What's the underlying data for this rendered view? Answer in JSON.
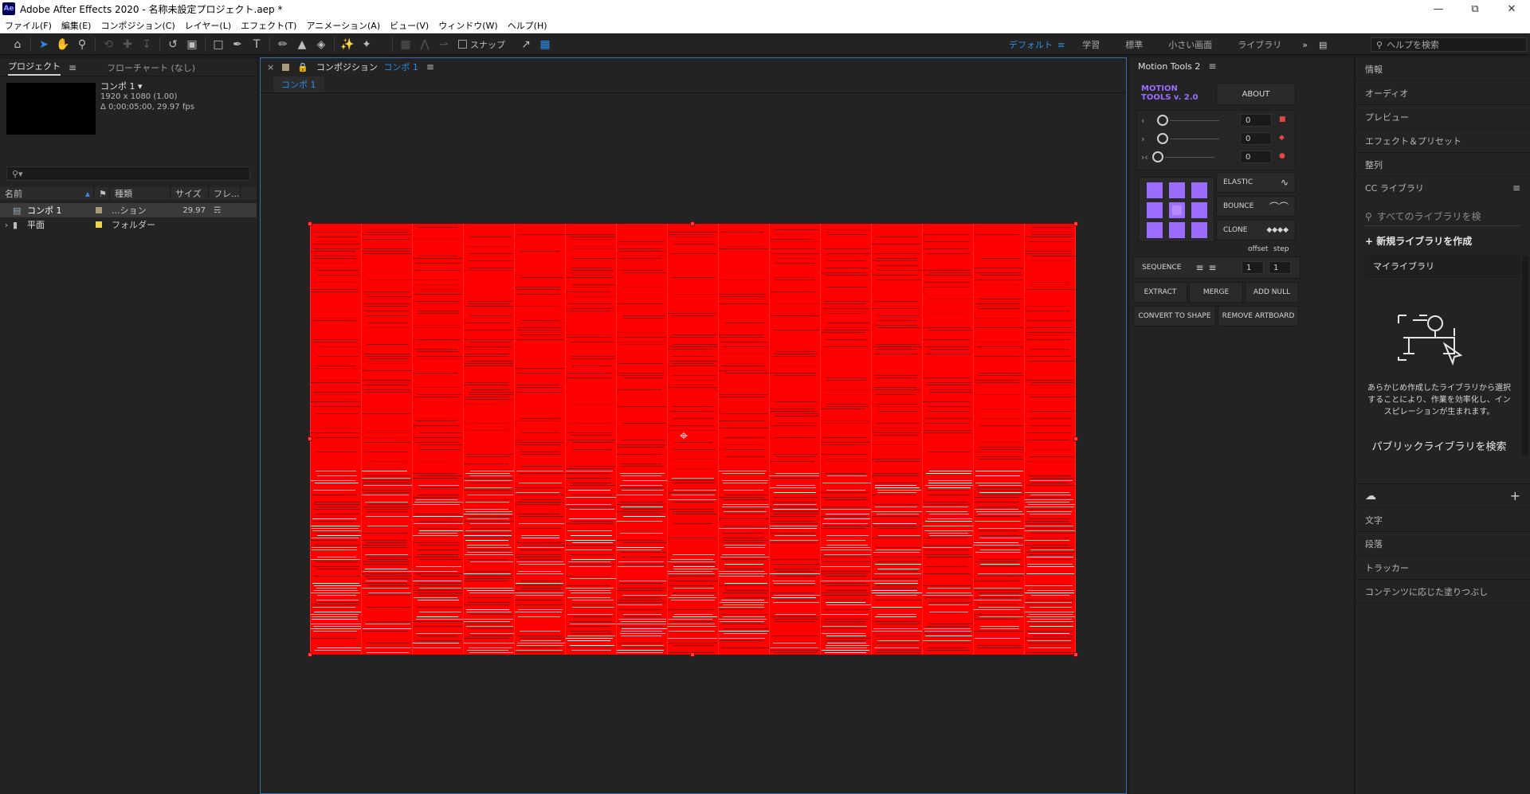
{
  "window": {
    "title": "Adobe After Effects 2020 - 名称未設定プロジェクト.aep *",
    "logo": "Ae"
  },
  "menu": [
    "ファイル(F)",
    "編集(E)",
    "コンポジション(C)",
    "レイヤー(L)",
    "エフェクト(T)",
    "アニメーション(A)",
    "ビュー(V)",
    "ウィンドウ(W)",
    "ヘルプ(H)"
  ],
  "toolbar": {
    "snap_label": "スナップ",
    "workspaces": [
      "デフォルト",
      "学習",
      "標準",
      "小さい画面",
      "ライブラリ"
    ],
    "active_workspace": "デフォルト",
    "search_placeholder": "ヘルプを検索"
  },
  "project": {
    "tab_project": "プロジェクト",
    "tab_flowchart": "フローチャート (なし)",
    "comp_name": "コンポ 1 ▾",
    "comp_size": "1920 x 1080 (1.00)",
    "comp_duration": "Δ 0;00;05;00, 29.97 fps",
    "columns": [
      "名前",
      "種類",
      "サイズ",
      "フレ..."
    ],
    "items": [
      {
        "name": "コンポ 1",
        "type": "...ション",
        "fps": "29.97",
        "color": "#a89a7a"
      },
      {
        "name": "平面",
        "type": "フォルダー",
        "fps": "",
        "color": "#e8d44d"
      }
    ]
  },
  "composition": {
    "tab_label": "コンポジション",
    "tab_comp_name": "コンポ 1",
    "sub_tab": "コンポ 1",
    "canvas_color": "#ff0000"
  },
  "motion_tools": {
    "title": "Motion Tools 2",
    "logo_line1": "MOTION",
    "logo_line2": "TOOLS v. 2.0",
    "about": "ABOUT",
    "slider_values": [
      "0",
      "0",
      "0"
    ],
    "elastic": "ELASTIC",
    "bounce": "BOUNCE",
    "clone": "CLONE",
    "offset": "offset",
    "step": "step",
    "sequence": "SEQUENCE",
    "seq_offset": "1",
    "seq_step": "1",
    "extract": "EXTRACT",
    "merge": "MERGE",
    "add_null": "ADD NULL",
    "convert_to_shape": "CONVERT TO SHAPE",
    "remove_artboard": "REMOVE ARTBOARD",
    "accent": "#9b6cff"
  },
  "right_panel": {
    "items_top": [
      "情報",
      "オーディオ",
      "プレビュー",
      "エフェクト＆プリセット",
      "整列"
    ],
    "cc_libraries": "CC ライブラリ",
    "cc_search_placeholder": "すべてのライブラリを検",
    "new_library": "+ 新規ライブラリを作成",
    "my_library": "マイライブラリ",
    "description": "あらかじめ作成したライブラリから選択することにより、作業を効率化し、インスピレーションが生まれます。",
    "public_library": "パブリックライブラリを検索",
    "items_bottom": [
      "文字",
      "段落",
      "トラッカー",
      "コンテンツに応じた塗りつぶし"
    ]
  }
}
